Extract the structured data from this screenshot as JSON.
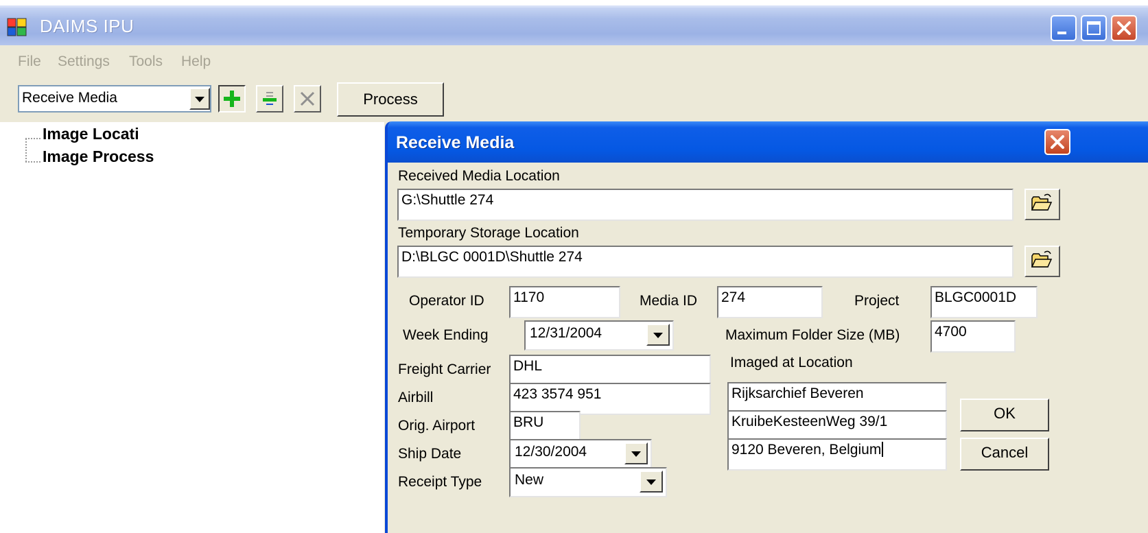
{
  "window": {
    "title": "DAIMS IPU"
  },
  "menu": [
    "File",
    "Settings",
    "Tools",
    "Help"
  ],
  "toolbar": {
    "mode_value": "Receive Media",
    "process_label": "Process"
  },
  "tree": {
    "items": [
      "Image Locati",
      "Image Process"
    ]
  },
  "dialog": {
    "title": "Receive Media",
    "received_location_label": "Received Media Location",
    "received_location_value": "G:\\Shuttle 274",
    "temp_location_label": "Temporary Storage Location",
    "temp_location_value": "D:\\BLGC 0001D\\Shuttle 274",
    "operator_id_label": "Operator ID",
    "operator_id_value": "1170",
    "media_id_label": "Media ID",
    "media_id_value": "274",
    "project_label": "Project",
    "project_value": "BLGC0001D",
    "week_ending_label": "Week Ending",
    "week_ending_value": "12/31/2004",
    "max_folder_label": "Maximum Folder Size (MB)",
    "max_folder_value": "4700",
    "freight_label": "Freight Carrier",
    "freight_value": "DHL",
    "airbill_label": "Airbill",
    "airbill_value": "423 3574 951",
    "airport_label": "Orig. Airport",
    "airport_value": "BRU",
    "ship_date_label": "Ship Date",
    "ship_date_value": "12/30/2004",
    "receipt_type_label": "Receipt Type",
    "receipt_type_value": "New",
    "imaged_label": "Imaged at Location",
    "imaged_line1": "Rijksarchief Beveren",
    "imaged_line2": "KruibeKesteenWeg 39/1",
    "imaged_line3": "9120 Beveren, Belgium",
    "ok_label": "OK",
    "cancel_label": "Cancel"
  },
  "colors": {
    "titlebar_inactive": "#a9bde9",
    "dialog_titlebar": "#0558e3",
    "close": "#c6472a",
    "face": "#ece9d8"
  },
  "icons": [
    "app-icon",
    "minimize-icon",
    "maximize-icon",
    "close-icon",
    "add-icon",
    "remove-icon",
    "delete-icon",
    "open-folder-icon",
    "dropdown-arrow-icon"
  ]
}
